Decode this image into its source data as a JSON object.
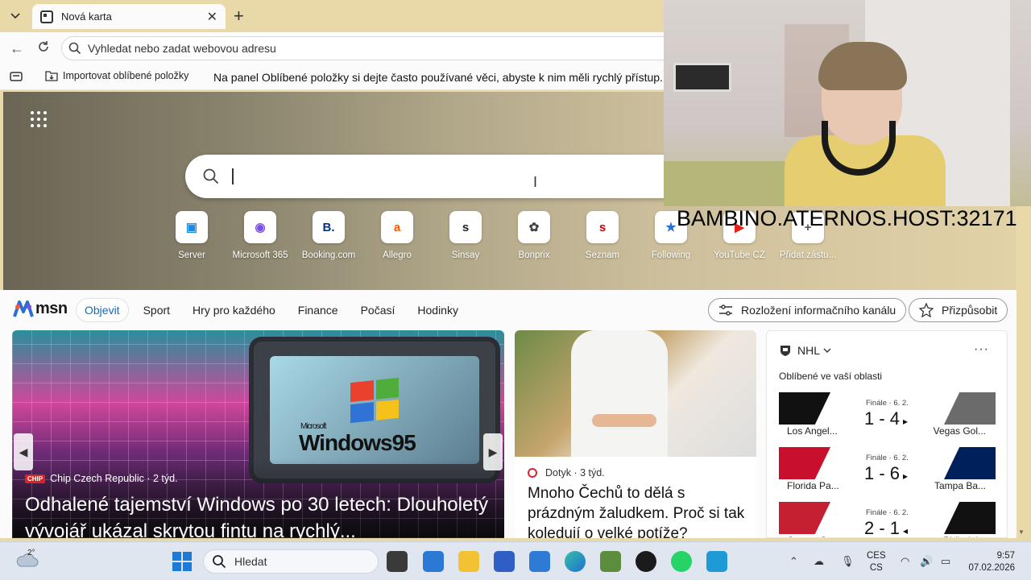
{
  "browser": {
    "tab_title": "Nová karta",
    "address_placeholder": "Vyhledat nebo zadat webovou adresu",
    "favorites_import_label": "Importovat oblíbené položky",
    "favorites_hint": "Na panel Oblíbené položky si dejte často používané věci, abyste k nim měli rychlý přístup. S"
  },
  "newtab": {
    "tiles": [
      {
        "label": "Server",
        "icon": "server-icon",
        "glyph": "▣",
        "color": "#1e88e5"
      },
      {
        "label": "Microsoft 365",
        "icon": "microsoft365-icon",
        "glyph": "◉",
        "color": "#7b4fe0"
      },
      {
        "label": "Booking.com",
        "icon": "booking-icon",
        "glyph": "B.",
        "color": "#003580"
      },
      {
        "label": "Allegro",
        "icon": "allegro-icon",
        "glyph": "a",
        "color": "#ff5a00"
      },
      {
        "label": "Sinsay",
        "icon": "sinsay-icon",
        "glyph": "s",
        "color": "#222222"
      },
      {
        "label": "Bonprix",
        "icon": "bonprix-icon",
        "glyph": "✿",
        "color": "#444444"
      },
      {
        "label": "Seznam",
        "icon": "seznam-icon",
        "glyph": "s",
        "color": "#cc0000"
      },
      {
        "label": "Following",
        "icon": "following-icon",
        "glyph": "★",
        "color": "#2b6fd6"
      },
      {
        "label": "YouTube CZ",
        "icon": "youtube-icon",
        "glyph": "▶",
        "color": "#e62117"
      },
      {
        "label": "Přidat zástu...",
        "icon": "add-shortcut-icon",
        "glyph": "+",
        "color": "#555555"
      }
    ]
  },
  "overlay": {
    "server_text": "BAMBINO.ATERNOS.HOST:32171"
  },
  "msn": {
    "logo_text": "msn",
    "tabs": [
      "Objevit",
      "Sport",
      "Hry pro každého",
      "Finance",
      "Počasí",
      "Hodinky"
    ],
    "active_tab": "Objevit",
    "layout_button": "Rozložení informačního kanálu",
    "customize_button": "Přizpůsobit"
  },
  "feed": {
    "main": {
      "source": "Chip Czech Republic",
      "age": "· 2 týd.",
      "badge": "CHIP",
      "headline": "Odhalené tajemství Windows po 30 letech: Dlouholetý vývojář ukázal skrytou fintu na rychlý...",
      "image_text_small": "Microsoft",
      "image_text_big": "Windows95"
    },
    "second": {
      "source": "Dotyk",
      "age": "· 3 týd.",
      "headline": "Mnoho Čechů to dělá s prázdným žaludkem. Proč si tak koledují o velké potíže?"
    },
    "nhl": {
      "title": "NHL",
      "subtitle": "Oblíbené ve vaší oblasti",
      "more": "···",
      "games": [
        {
          "status": "Finále · 6. 2.",
          "score": "1 - 4",
          "arrow": "▸",
          "team1": "Los Angel...",
          "team2": "Vegas Gol...",
          "color1": "#111111",
          "color2": "#6b6b6b"
        },
        {
          "status": "Finále · 6. 2.",
          "score": "1 - 6",
          "arrow": "▸",
          "team1": "Florida Pa...",
          "team2": "Tampa Ba...",
          "color1": "#c8102e",
          "color2": "#00205b"
        },
        {
          "status": "Finále · 6. 2.",
          "score": "2 - 1",
          "arrow": "◂",
          "team1": "Ottawa S...",
          "team2": "Philadel...",
          "color1": "#c52032",
          "color2": "#111111"
        }
      ]
    }
  },
  "taskbar": {
    "temperature": "2°",
    "search_label": "Hledat",
    "lang_top": "CES",
    "lang_bottom": "CS",
    "time": "9:57",
    "date": "07.02.2026"
  }
}
